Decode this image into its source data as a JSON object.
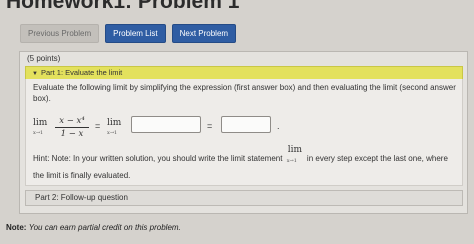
{
  "page": {
    "title": "Homework1: Problem 1"
  },
  "nav": {
    "previous_label": "Previous Problem",
    "list_label": "Problem List",
    "next_label": "Next Problem"
  },
  "problem": {
    "points": "(5 points)",
    "part1": {
      "header": "Part 1: Evaluate the limit",
      "prompt": "Evaluate the following limit by simplifying the expression (first answer box) and then evaluating the limit (second answer box).",
      "math": {
        "lim": "lim",
        "sub": "x→1",
        "numerator": "x − x⁴",
        "denominator": "1 − x",
        "equals": "=",
        "period": "."
      },
      "answer1_value": "",
      "answer2_value": "",
      "hint_before": "Hint: Note: In your written solution, you should write the limit statement",
      "hint_lim": "lim",
      "hint_sub": "x→1",
      "hint_after": "in every step except the last one, where the limit is finally evaluated."
    },
    "part2": {
      "header": "Part 2: Follow-up question"
    }
  },
  "footer": {
    "note_label": "Note:",
    "note_text": "You can earn partial credit on this problem."
  },
  "colors": {
    "part1_bar": "#e3e15d",
    "button_primary": "#2f5da3",
    "button_disabled": "#c3c0bb"
  },
  "icons": {
    "part1_toggle": "caret-down-icon"
  }
}
